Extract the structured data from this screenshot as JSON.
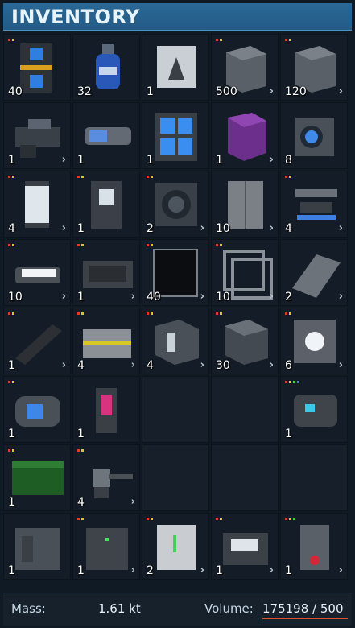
{
  "title": "INVENTORY",
  "colors": {
    "header": "#2a6896",
    "volume_overflow": "#e0522b",
    "indicator_red": "#e23b2e",
    "indicator_yellow": "#e6c22a",
    "indicator_green": "#4fcf48",
    "indicator_blue": "#3a7fe0"
  },
  "slots": [
    {
      "icon": "battery-icon",
      "qty": "40",
      "chevron": "",
      "dots": [
        "red",
        "yellow"
      ]
    },
    {
      "icon": "hydrogen-bottle-icon",
      "qty": "32",
      "chevron": "",
      "dots": []
    },
    {
      "icon": "ammo-container-icon",
      "qty": "1",
      "chevron": "",
      "dots": []
    },
    {
      "icon": "armor-block-icon",
      "qty": "500",
      "chevron": "›",
      "dots": [
        "red",
        "yellow"
      ]
    },
    {
      "icon": "armor-slope-block-icon",
      "qty": "120",
      "chevron": "›",
      "dots": [
        "red",
        "yellow"
      ]
    },
    {
      "icon": "cockpit-icon",
      "qty": "1",
      "chevron": "›",
      "dots": []
    },
    {
      "icon": "thruster-icon",
      "qty": "1",
      "chevron": "",
      "dots": []
    },
    {
      "icon": "battery-array-icon",
      "qty": "1",
      "chevron": "",
      "dots": []
    },
    {
      "icon": "purple-container-icon",
      "qty": "1",
      "chevron": "›",
      "dots": []
    },
    {
      "icon": "camera-block-icon",
      "qty": "8",
      "chevron": "",
      "dots": []
    },
    {
      "icon": "cryo-chamber-icon",
      "qty": "4",
      "chevron": "›",
      "dots": [
        "red",
        "yellow"
      ]
    },
    {
      "icon": "medical-room-icon",
      "qty": "1",
      "chevron": "",
      "dots": [
        "red",
        "yellow"
      ]
    },
    {
      "icon": "conveyor-junction-icon",
      "qty": "2",
      "chevron": "›",
      "dots": [
        "red",
        "yellow"
      ]
    },
    {
      "icon": "door-icon",
      "qty": "10",
      "chevron": "›",
      "dots": []
    },
    {
      "icon": "landing-gear-icon",
      "qty": "4",
      "chevron": "›",
      "dots": [
        "red",
        "yellow"
      ]
    },
    {
      "icon": "interior-light-icon",
      "qty": "10",
      "chevron": "›",
      "dots": [
        "red",
        "yellow"
      ]
    },
    {
      "icon": "vent-panel-icon",
      "qty": "1",
      "chevron": "›",
      "dots": [
        "red",
        "yellow"
      ]
    },
    {
      "icon": "window-icon",
      "qty": "40",
      "chevron": "›",
      "dots": [
        "red",
        "yellow"
      ]
    },
    {
      "icon": "frame-block-icon",
      "qty": "10",
      "chevron": "›",
      "dots": [
        "red",
        "yellow"
      ]
    },
    {
      "icon": "ramp-block-icon",
      "qty": "2",
      "chevron": "›",
      "dots": []
    },
    {
      "icon": "ramp-slope-icon",
      "qty": "1",
      "chevron": "›",
      "dots": [
        "red",
        "yellow"
      ]
    },
    {
      "icon": "cargo-container-icon",
      "qty": "4",
      "chevron": "›",
      "dots": [
        "red",
        "yellow"
      ]
    },
    {
      "icon": "armored-cube-icon",
      "qty": "4",
      "chevron": "›",
      "dots": [
        "red",
        "yellow"
      ]
    },
    {
      "icon": "reinforced-cube-icon",
      "qty": "30",
      "chevron": "›",
      "dots": [
        "red",
        "yellow"
      ]
    },
    {
      "icon": "light-cube-icon",
      "qty": "6",
      "chevron": "›",
      "dots": [
        "red",
        "yellow"
      ]
    },
    {
      "icon": "reactor-icon",
      "qty": "1",
      "chevron": "",
      "dots": [
        "red",
        "yellow"
      ]
    },
    {
      "icon": "pink-console-icon",
      "qty": "1",
      "chevron": "",
      "dots": []
    },
    {
      "icon": "",
      "qty": "",
      "chevron": "",
      "dots": []
    },
    {
      "icon": "",
      "qty": "",
      "chevron": "",
      "dots": []
    },
    {
      "icon": "turret-housing-icon",
      "qty": "1",
      "chevron": "",
      "dots": [
        "red",
        "yellow",
        "green",
        "blue"
      ]
    },
    {
      "icon": "green-cargo-icon",
      "qty": "1",
      "chevron": "",
      "dots": [
        "red",
        "yellow"
      ]
    },
    {
      "icon": "gatling-turret-icon",
      "qty": "4",
      "chevron": "›",
      "dots": [
        "red",
        "yellow"
      ]
    },
    {
      "icon": "",
      "qty": "",
      "chevron": "",
      "dots": []
    },
    {
      "icon": "",
      "qty": "",
      "chevron": "",
      "dots": []
    },
    {
      "icon": "",
      "qty": "",
      "chevron": "",
      "dots": []
    },
    {
      "icon": "refinery-icon",
      "qty": "1",
      "chevron": "",
      "dots": []
    },
    {
      "icon": "assembler-icon",
      "qty": "1",
      "chevron": "›",
      "dots": [
        "red",
        "yellow"
      ]
    },
    {
      "icon": "survival-kit-icon",
      "qty": "2",
      "chevron": "›",
      "dots": [
        "red",
        "yellow"
      ]
    },
    {
      "icon": "workstation-icon",
      "qty": "1",
      "chevron": "›",
      "dots": [
        "red",
        "yellow"
      ]
    },
    {
      "icon": "red-sensor-block-icon",
      "qty": "1",
      "chevron": "›",
      "dots": [
        "red",
        "yellow",
        "green"
      ]
    }
  ],
  "footer": {
    "mass_label": "Mass:",
    "mass_value": "1.61 kt",
    "volume_label": "Volume:",
    "volume_value": "175198 / 500"
  }
}
